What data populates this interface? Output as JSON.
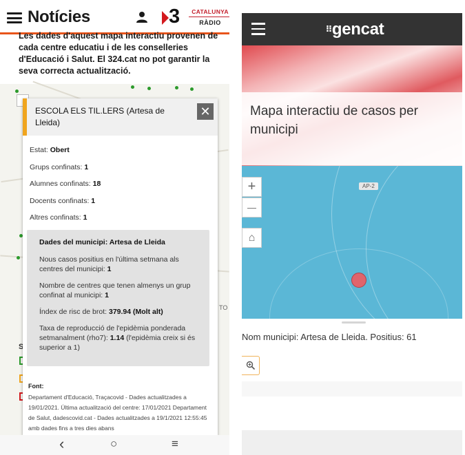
{
  "left_app": {
    "header": {
      "title": "Notícies",
      "logo_3": "3",
      "radio_line1": "CATALUNYA",
      "radio_line2": "RÀDIO"
    },
    "intro_text": "Les dades d'aquest mapa interactiu provenen de cada centre educatiu i de les conselleries d'Educació i Salut. El 324.cat no pot garantir la seva correcta actualització.",
    "popup": {
      "school_name": "ESCOLA ELS TIL.LERS (Artesa de Lleida)",
      "close_label": "✕",
      "rows": [
        {
          "label": "Estat: ",
          "value": "Obert"
        },
        {
          "label": "Grups confinats: ",
          "value": "1"
        },
        {
          "label": "Alumnes confinats: ",
          "value": "18"
        },
        {
          "label": "Docents confinats: ",
          "value": "1"
        },
        {
          "label": "Altres confinats: ",
          "value": "1"
        }
      ],
      "municipality": {
        "title": "Dades del municipi: Artesa de Lleida",
        "rows": [
          {
            "label": "Nous casos positius en l'última setmana als centres del municipi: ",
            "value": "1",
            "suffix": ""
          },
          {
            "label": "Nombre de centres que tenen almenys un grup confinat al municipi: ",
            "value": "1",
            "suffix": ""
          },
          {
            "label": "Índex de risc de brot: ",
            "value": "379.94 (Molt alt)",
            "suffix": ""
          },
          {
            "label": "Taxa de reproducció de l'epidèmia ponderada setmanalment (rho7): ",
            "value": "1.14",
            "suffix": " (l'epidèmia creix si és superior a 1)"
          }
        ]
      },
      "source_title": "Font:",
      "source_text": "Departament d'Educació, Traçacovid - Dades actualitzades a 19/01/2021. Última actualització del centre: 17/01/2021 Departament de Salut, dadescovid.cat - Dades actualitzades a 19/1/2021 12:55:45 amb dades fins a tres dies abans"
    },
    "map_side_letter": "S",
    "map_side_to": "TO",
    "nav": {
      "back": "‹",
      "home": "○",
      "menu": "≡"
    }
  },
  "right_app": {
    "header": {
      "logo_mark": "⁝⁝",
      "logo_text": "gencat"
    },
    "banner_title": "Mapa interactiu de casos per municipi",
    "map": {
      "zoom_in": "+",
      "zoom_out": "—",
      "home": "⌂",
      "road_label": "AP-2"
    },
    "info_text": "Nom municipi: Artesa de Lleida. Positius: 61"
  },
  "colors": {
    "left_accent": "#e8541a",
    "popup_accent": "#f0a51e",
    "gencat_header": "#333333",
    "map_water": "#5bb7d6",
    "marker": "#e0646c"
  }
}
